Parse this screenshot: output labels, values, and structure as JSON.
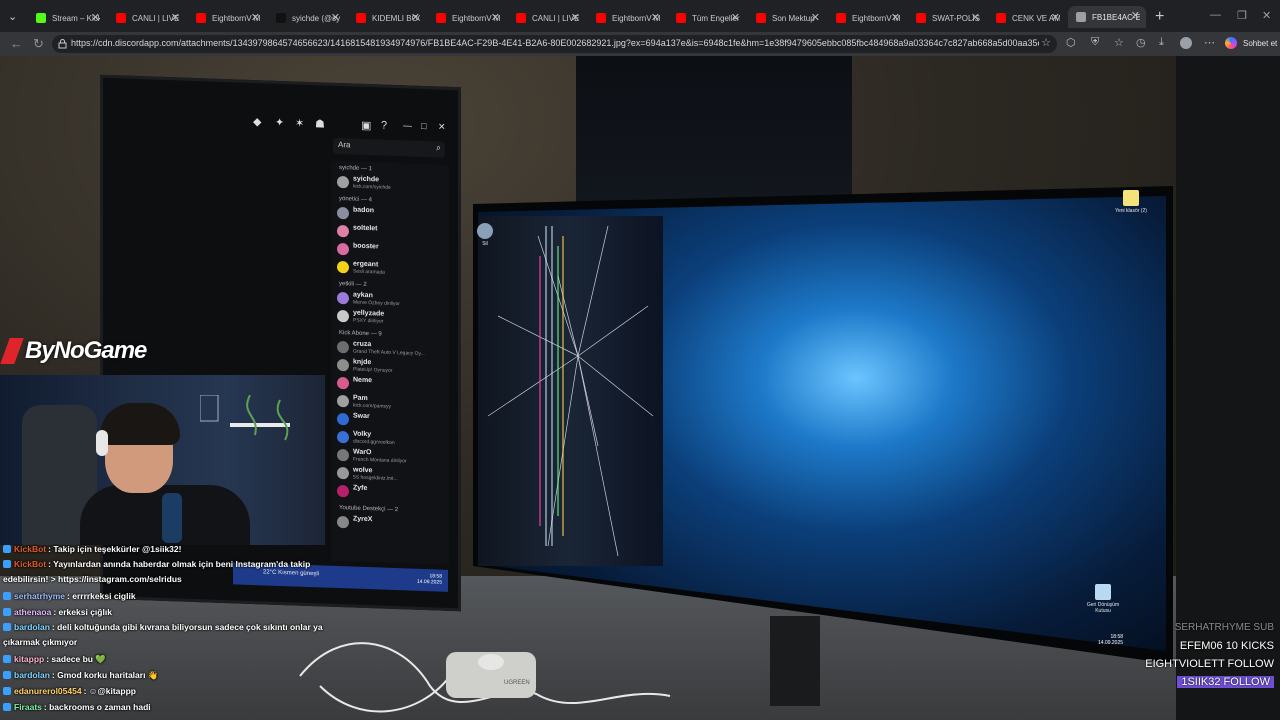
{
  "browser": {
    "tabs": [
      {
        "title": "Stream – Kick",
        "favicon": "kick-icon",
        "color": "#53fc18"
      },
      {
        "title": "CANLI | LIVE",
        "favicon": "youtube-icon",
        "color": "#ff0000"
      },
      {
        "title": "EightbornV Mixes",
        "favicon": "youtube-icon",
        "color": "#ff0000"
      },
      {
        "title": "syichde (@syichde)",
        "favicon": "tiktok-icon",
        "color": "#111111"
      },
      {
        "title": "KIDEMLI BOOM",
        "favicon": "youtube-icon",
        "color": "#ff0000"
      },
      {
        "title": "EightbornV Mixes",
        "favicon": "youtube-icon",
        "color": "#ff0000"
      },
      {
        "title": "CANLI | LIVE",
        "favicon": "youtube-icon",
        "color": "#ff0000"
      },
      {
        "title": "EightbornV Mixes",
        "favicon": "youtube-icon",
        "color": "#ff0000"
      },
      {
        "title": "Tüm Engelleri",
        "favicon": "youtube-icon",
        "color": "#ff0000"
      },
      {
        "title": "Son Mektup",
        "favicon": "youtube-icon",
        "color": "#ff0000"
      },
      {
        "title": "EightbornV Mixes",
        "favicon": "youtube-icon",
        "color": "#ff0000"
      },
      {
        "title": "SWAT-POLIS",
        "favicon": "youtube-icon",
        "color": "#ff0000"
      },
      {
        "title": "CENK VE AMCA",
        "favicon": "youtube-icon",
        "color": "#ff0000"
      },
      {
        "title": "FB1BE4AC-E29B",
        "favicon": "globe-icon",
        "color": "#9aa0a6",
        "active": true
      }
    ],
    "url": "https://cdn.discordapp.com/attachments/1343979864574656623/1416815481934974976/FB1BE4AC-F29B-4E41-B2A6-80E002682921.jpg?ex=694a137e&is=6948c1fe&hm=1e38f9479605ebbc085fbc484968a9a03364c7c827ab668a5d00aa35e68...",
    "copilot_label": "Sohbet et"
  },
  "stream": {
    "logo_text": "ByNoGame",
    "left_monitor": {
      "search_placeholder": "Ara",
      "groups": [
        {
          "header": "syichde — 1",
          "users": [
            {
              "name": "syichde",
              "sub": "kick.com/syichde",
              "color": "#a0a0a0"
            }
          ]
        },
        {
          "header": "yönetici — 4",
          "users": [
            {
              "name": "badon",
              "sub": "",
              "color": "#8a8fa0"
            },
            {
              "name": "soltelet",
              "sub": "",
              "color": "#e07fa8"
            },
            {
              "name": "booster",
              "sub": "",
              "color": "#d96ba0"
            },
            {
              "name": "ergeant",
              "sub": "Sesli aramada",
              "color": "#f3d21b"
            }
          ]
        },
        {
          "header": "yetkili — 2",
          "users": [
            {
              "name": "aykan",
              "sub": "Merve Özbey dinliyor",
              "color": "#9b7bd9"
            },
            {
              "name": "yellyzade",
              "sub": "PSXY dinliyor",
              "color": "#c9c9c9"
            }
          ]
        },
        {
          "header": "Kick Abone — 9",
          "users": [
            {
              "name": "cruza",
              "sub": "Grand Theft Auto V Legacy Oy...",
              "color": "#6d6d6d"
            },
            {
              "name": "knjde",
              "sub": "PlateUp! Oynuyor",
              "color": "#8d8d8d"
            },
            {
              "name": "Neme",
              "sub": "",
              "color": "#d85b8e"
            },
            {
              "name": "Pam",
              "sub": "kick.com/pamsyy",
              "color": "#a0a0a0"
            },
            {
              "name": "Swar",
              "sub": "",
              "color": "#2d6bd3"
            },
            {
              "name": "Volky",
              "sub": "discord.gg/voolkan",
              "color": "#3b6fd8"
            },
            {
              "name": "WarO",
              "sub": "French Montana dinliyor",
              "color": "#777"
            },
            {
              "name": "wolve",
              "sub": "5S hosgeldiniz.lmt...",
              "color": "#999"
            },
            {
              "name": "Zyfe",
              "sub": "",
              "color": "#b5206a"
            }
          ]
        },
        {
          "header": "Youtube Destekçi — 2",
          "users": [
            {
              "name": "ZyreX",
              "sub": "",
              "color": "#888"
            }
          ]
        }
      ],
      "weather": "22°C Kısmen güneşli",
      "clock_time": "18:58",
      "clock_date": "14.09.2025"
    },
    "right_monitor": {
      "icon_top_left": "Sil",
      "icon_top_right": "Yeni klasör (2)",
      "icon_bottom_right": "Geri Dönüşüm Kutusu",
      "clock_time": "18:58",
      "clock_date": "14.09.2025"
    },
    "hub_text": "UGREEN",
    "chat": [
      {
        "user": "KickBot",
        "color": "#e05a2a",
        "text": ": Takip için teşekkürler @1siik32!"
      },
      {
        "user": "KickBot",
        "color": "#e05a2a",
        "text": ": Yayınlardan anında haberdar olmak için beni Instagram'da takip edebilirsin! > https://instagram.com/selridus"
      },
      {
        "user": "serhatrhyme",
        "color": "#9fb9ff",
        "text": ": errrrkeksi ciglik"
      },
      {
        "user": "athenaoa",
        "color": "#e3b7ff",
        "text": ": erkeksi çığlık"
      },
      {
        "user": "bardolan",
        "color": "#7fd6ff",
        "text": ": deli koltuğunda gibi kıvrana biliyorsun sadece çok sıkıntı onlar ya çıkarmak çıkmıyor"
      },
      {
        "user": "kitappp",
        "color": "#ffb3d1",
        "text": ": sadece bu 💚"
      },
      {
        "user": "bardolan",
        "color": "#7fd6ff",
        "text": ": Gmod korku haritaları 👋"
      },
      {
        "user": "edanurerol05454",
        "color": "#ffd36b",
        "text": ": ☺@kitappp"
      },
      {
        "user": "Firaats",
        "color": "#7df0a2",
        "text": ": backrooms o zaman hadi"
      }
    ],
    "events": [
      {
        "text": "SERHATRHYME  SUB",
        "style": "dim"
      },
      {
        "text": "EFEM06  10 KICKS",
        "style": "normal"
      },
      {
        "text": "EIGHTVIOLETT  FOLLOW",
        "style": "normal"
      },
      {
        "text": "1SIIK32  FOLLOW",
        "style": "highlight"
      }
    ]
  },
  "colors": {
    "brand_red": "#e0242b",
    "highlight_purple": "#6f4fd6",
    "kick_green": "#53fc18"
  }
}
